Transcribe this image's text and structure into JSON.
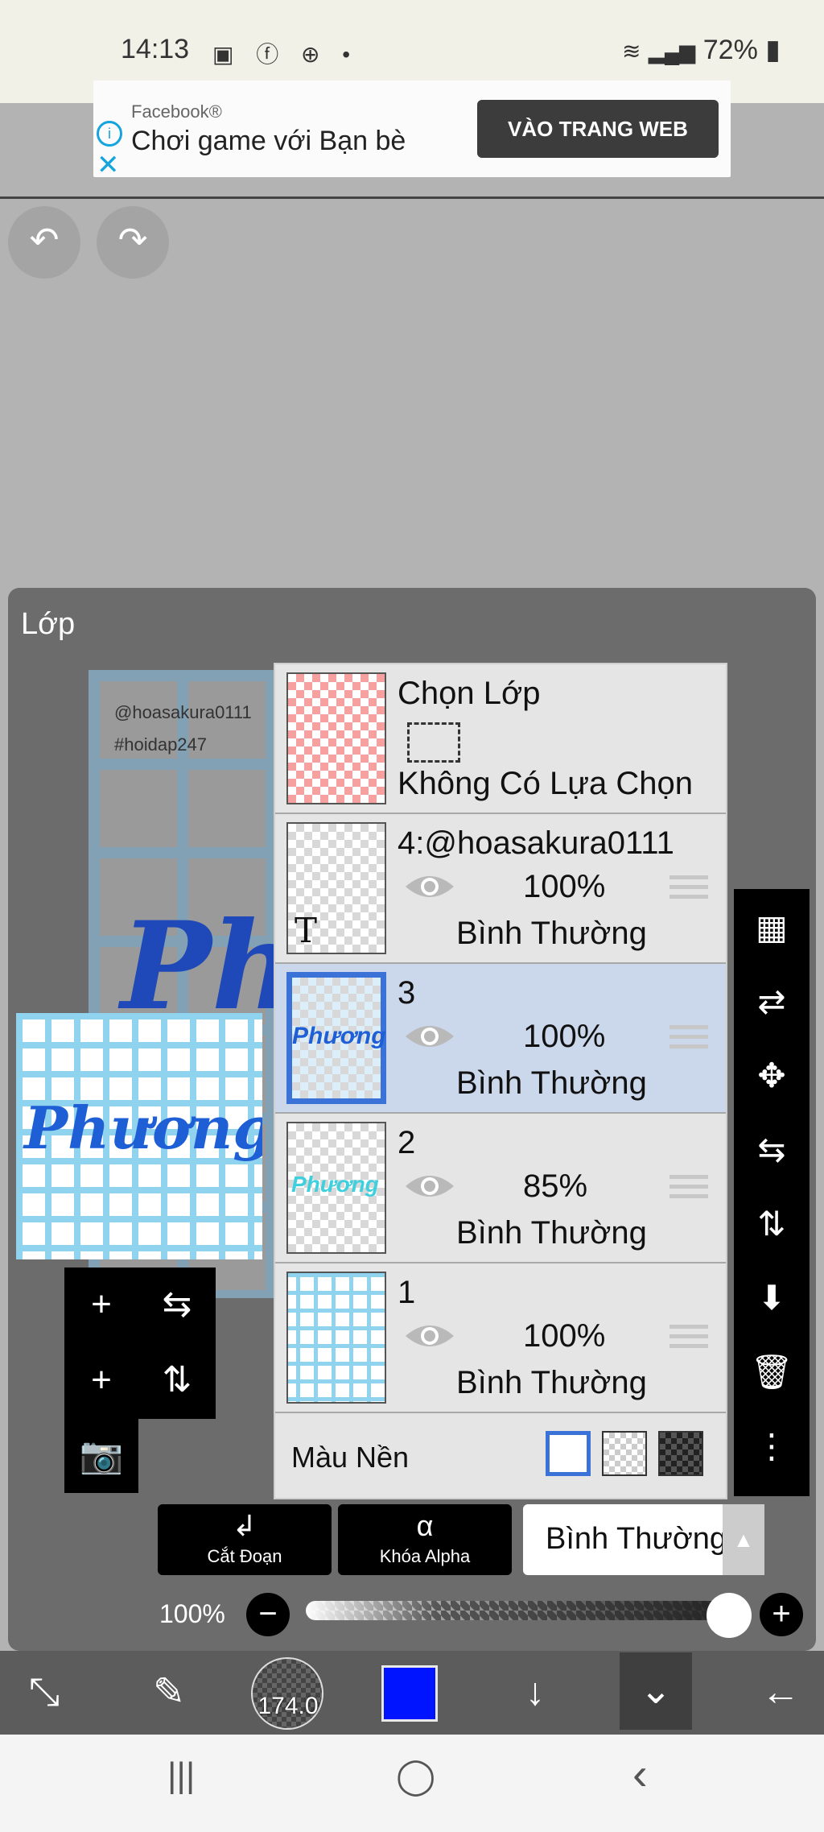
{
  "status_bar": {
    "time": "14:13",
    "icons_left": "▣ ⓕ ⊕ •",
    "battery": "72%"
  },
  "ad": {
    "brand": "Facebook®",
    "text": "Chơi game với Bạn bè",
    "button": "VÀO TRANG WEB"
  },
  "toolbar_top": {
    "undo_icon": "↶",
    "redo_icon": "↷"
  },
  "panel": {
    "title": "Lớp",
    "canvas_tags": [
      "@hoasakura0111",
      "#hoidap247"
    ],
    "canvas_big_text": "Ph",
    "preview_word": "Phương"
  },
  "layers": {
    "selection": {
      "title": "Chọn Lớp",
      "subtitle": "Không Có Lựa Chọn"
    },
    "items": [
      {
        "name": "4:@hoasakura0111",
        "opacity": "100%",
        "mode": "Bình Thường",
        "thumb_text": "T"
      },
      {
        "name": "3",
        "opacity": "100%",
        "mode": "Bình Thường",
        "thumb_text": "Phương"
      },
      {
        "name": "2",
        "opacity": "85%",
        "mode": "Bình Thường",
        "thumb_text": "Phương"
      },
      {
        "name": "1",
        "opacity": "100%",
        "mode": "Bình Thường",
        "thumb_text": ""
      }
    ],
    "background_label": "Màu Nền"
  },
  "left_tools": {
    "add": "+",
    "add_copy": "+",
    "camera": "📷",
    "flip_h": "⇆",
    "flip_v": "⇅"
  },
  "right_tools": [
    "▦",
    "⇄",
    "✥",
    "⇆",
    "⇅",
    "⬇",
    "🗑",
    "⋮"
  ],
  "bottom_controls": {
    "clip_label": "Cắt Đoạn",
    "alpha_label": "Khóa Alpha",
    "blend_mode": "Bình Thường",
    "opacity": "100%"
  },
  "bottom_bar": {
    "brush_size": "174.0",
    "primary_color": "#0014ff"
  },
  "system_nav": {
    "recent": "|||",
    "home": "◯",
    "back": "‹"
  }
}
